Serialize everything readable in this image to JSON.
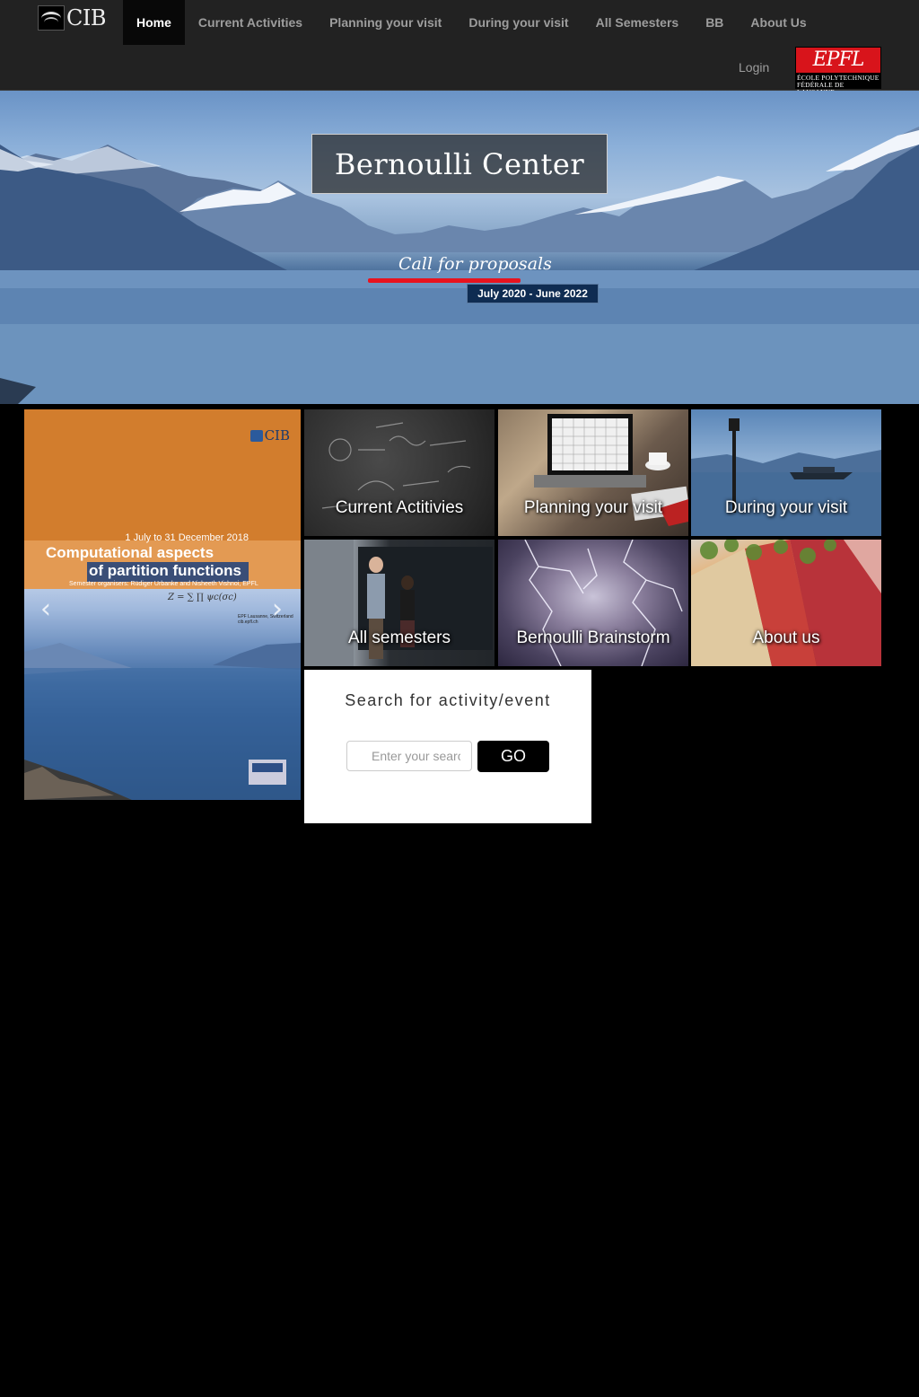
{
  "brand": {
    "logo_text": "CIB"
  },
  "nav": {
    "items": [
      {
        "label": "Home",
        "active": true
      },
      {
        "label": "Current Activities",
        "active": false
      },
      {
        "label": "Planning your visit",
        "active": false
      },
      {
        "label": "During your visit",
        "active": false
      },
      {
        "label": "All Semesters",
        "active": false
      },
      {
        "label": "BB",
        "active": false
      },
      {
        "label": "About Us",
        "active": false
      }
    ],
    "login": "Login",
    "partner_logo": {
      "word": "EPFL",
      "line1": "ÉCOLE POLYTECHNIQUE",
      "line2": "FÉDÉRALE DE LAUSANNE"
    }
  },
  "hero": {
    "title": "Bernoulli Center",
    "call_link": "Call for proposals",
    "dates": "July 2020 - June 2022"
  },
  "carousel": {
    "slide": {
      "logo": "CIB",
      "dates": "1 July to 31 December 2018",
      "title_line1": "Computational aspects",
      "title_line2": "of partition functions",
      "organisers": "Semester organisers: Rüdiger Urbanke and Nisheeth Vishnoi, EPFL",
      "formula": "Z = ∑ ∏ ψc(σc)",
      "venue_line1": "EPF Lausanne, Switzerland",
      "venue_line2": "cib.epfl.ch"
    },
    "prev_icon": "chevron-left-icon",
    "next_icon": "chevron-right-icon"
  },
  "tiles": [
    {
      "label": "Current Actitivies"
    },
    {
      "label": "Planning your visit"
    },
    {
      "label": "During your visit"
    },
    {
      "label": "All semesters"
    },
    {
      "label": "Bernoulli Brainstorm"
    },
    {
      "label": "About us"
    }
  ],
  "search": {
    "title": "Search for activity/event",
    "placeholder": "Enter your search",
    "button": "GO"
  },
  "colors": {
    "accent_red": "#e8131e",
    "navbar": "#222222",
    "date_badge": "#0f2c52"
  }
}
